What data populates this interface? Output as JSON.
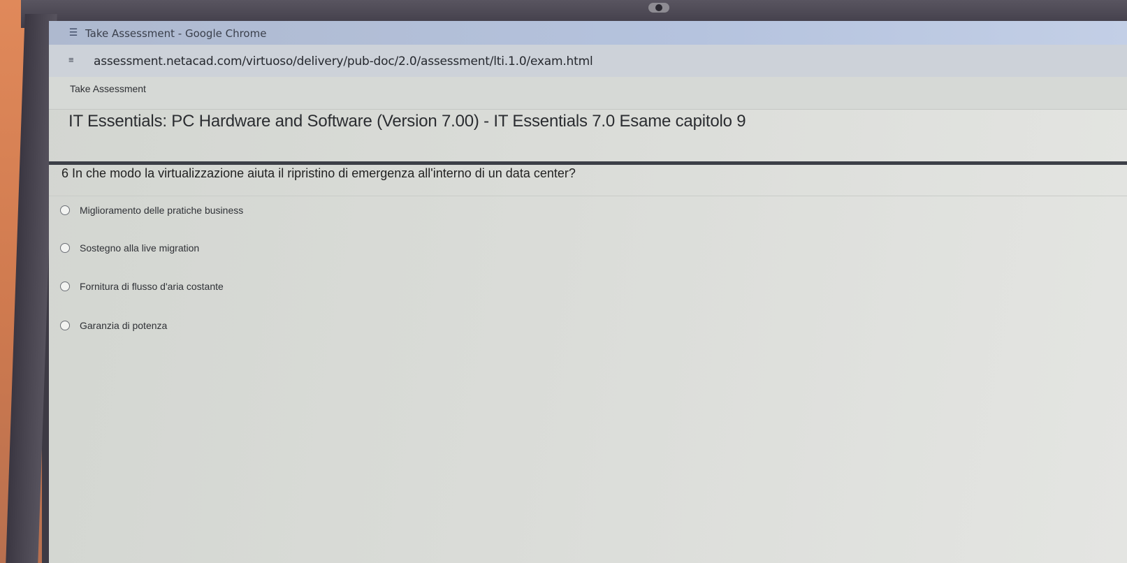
{
  "window": {
    "title": "Take Assessment - Google Chrome",
    "app_icon": "assessment-icon"
  },
  "address_bar": {
    "url": "assessment.netacad.com/virtuoso/delivery/pub-doc/2.0/assessment/lti.1.0/exam.html",
    "site_info_icon": "tune-icon"
  },
  "page": {
    "header": "Take Assessment",
    "exam_title": "IT Essentials: PC Hardware and Software (Version 7.00) - IT Essentials 7.0 Esame capitolo 9"
  },
  "question": {
    "number": "6",
    "text": "In che modo la virtualizzazione aiuta il ripristino di emergenza all'interno di un data center?",
    "options": [
      {
        "label": "Miglioramento delle pratiche business",
        "selected": false
      },
      {
        "label": "Sostegno alla live migration",
        "selected": false
      },
      {
        "label": "Fornitura di flusso d'aria costante",
        "selected": false
      },
      {
        "label": "Garanzia di potenza",
        "selected": false
      }
    ]
  }
}
